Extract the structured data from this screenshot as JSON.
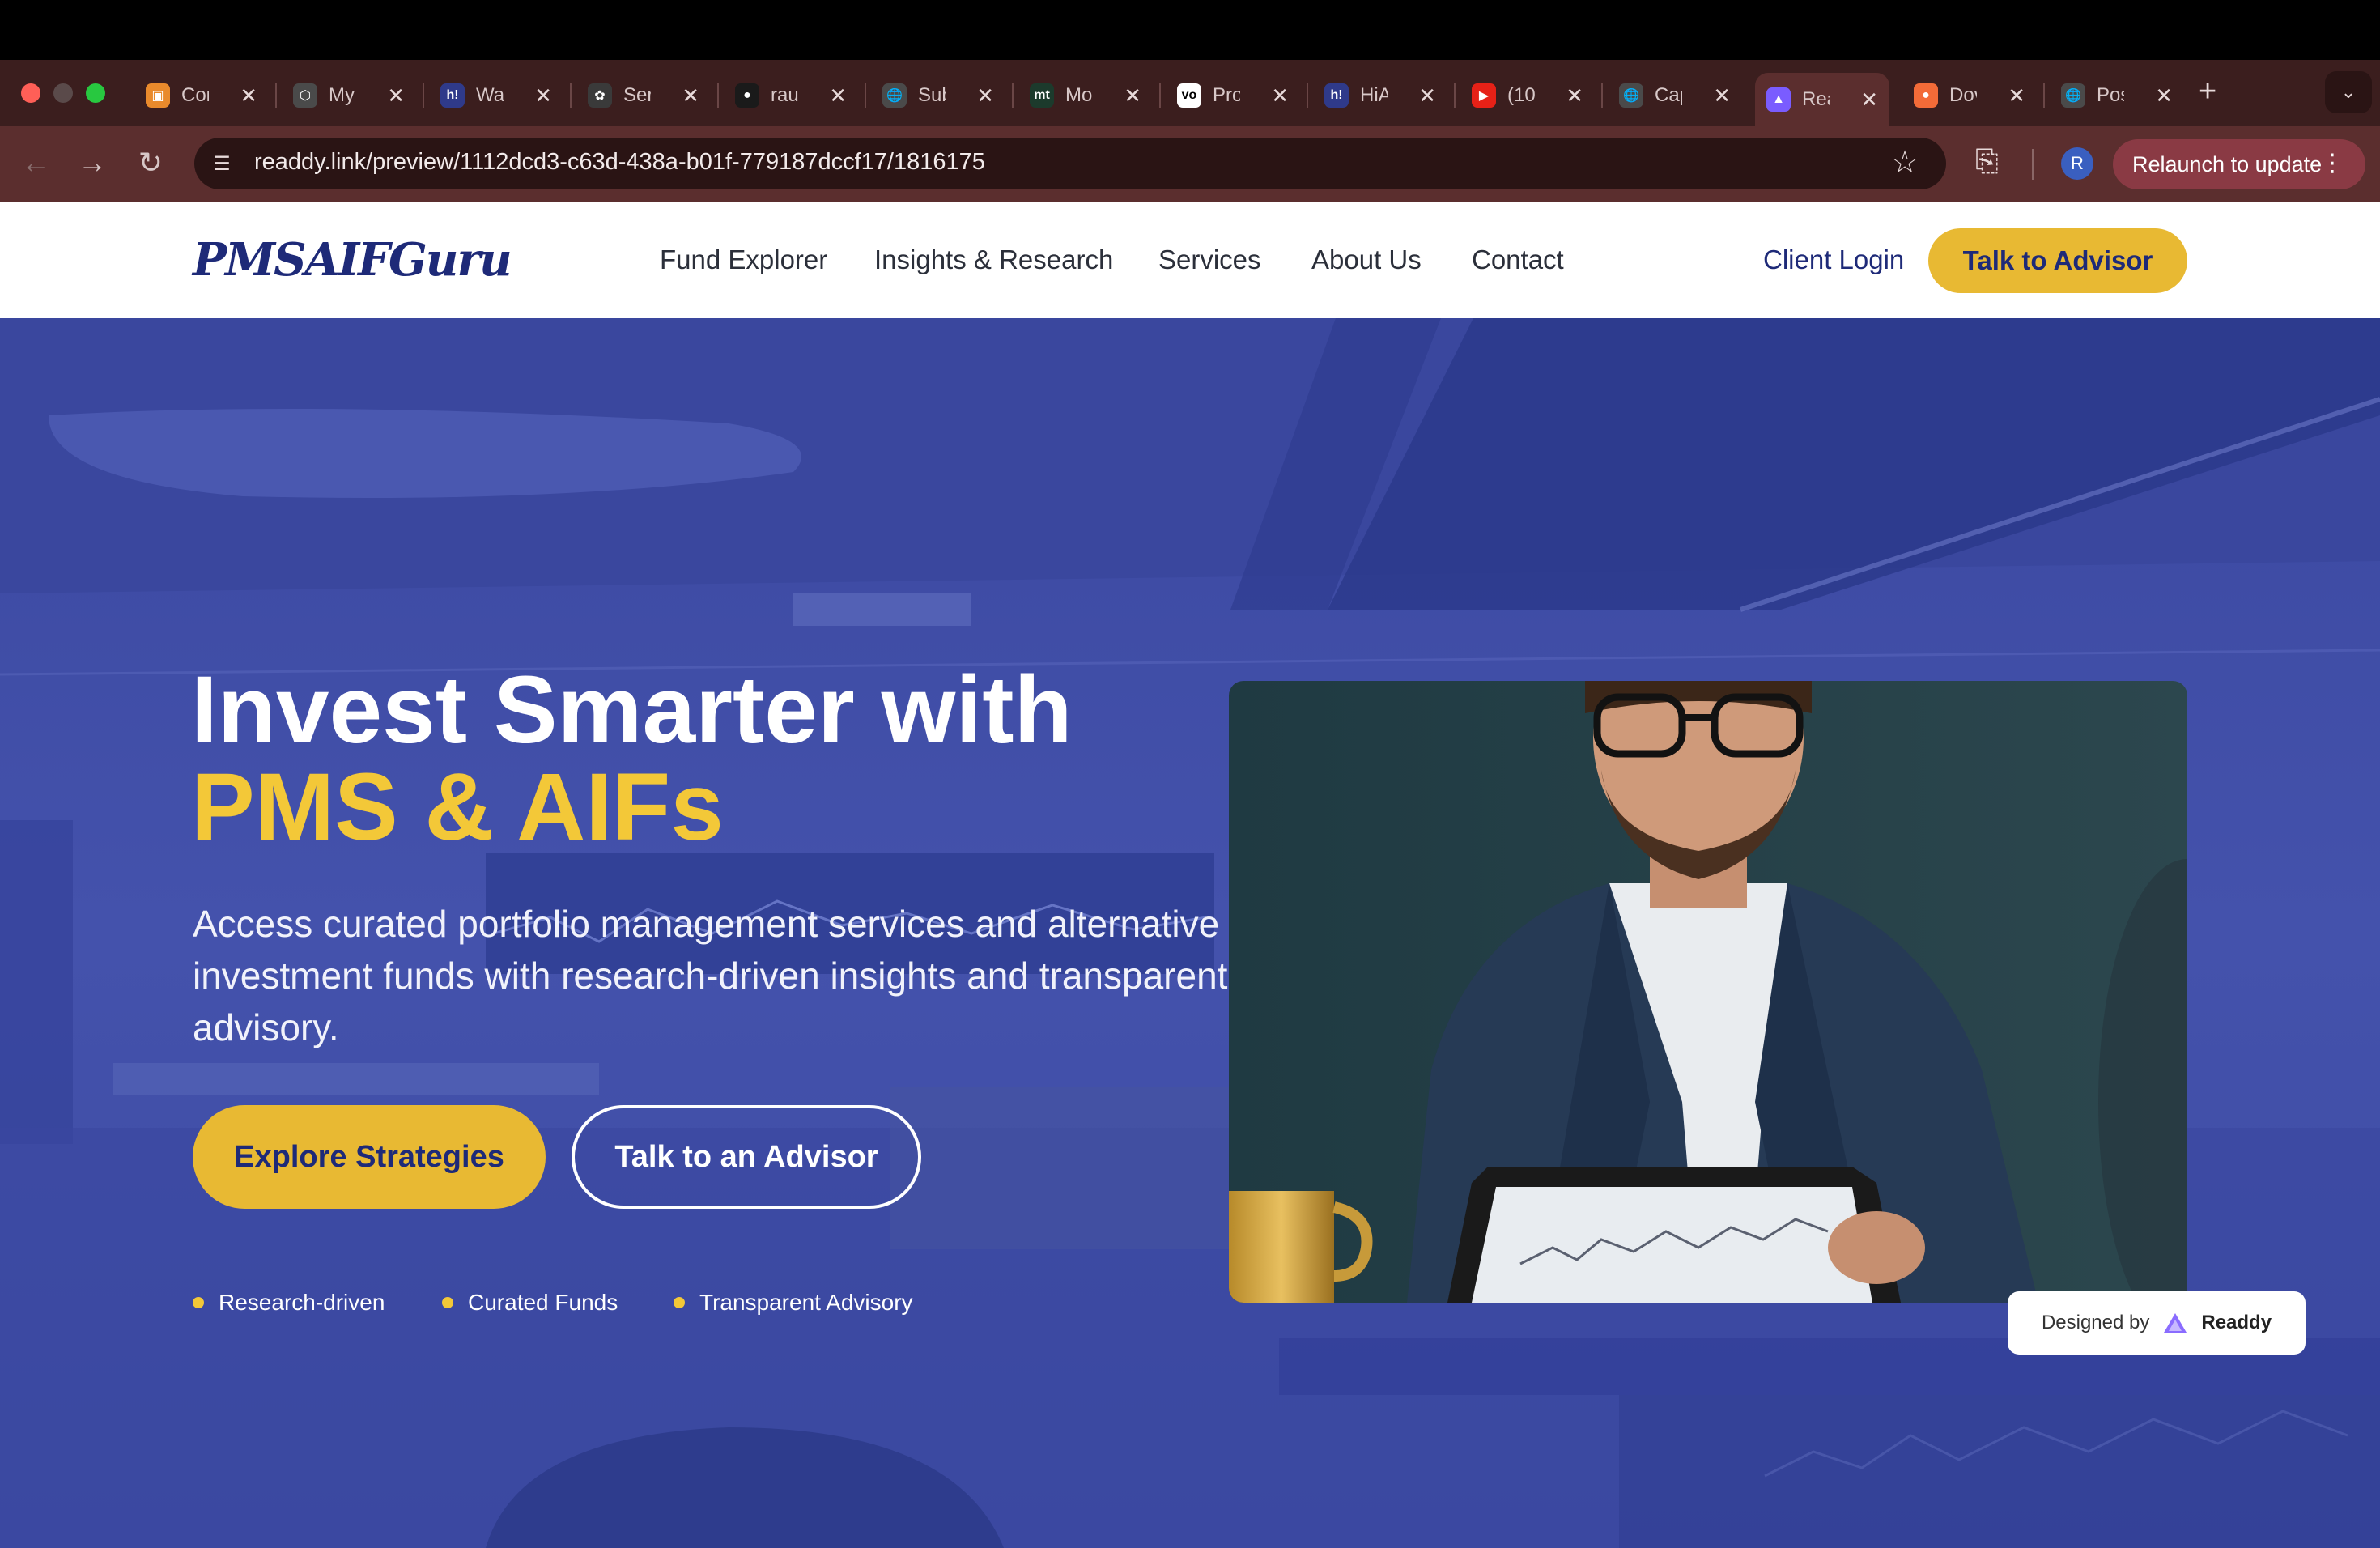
{
  "browser": {
    "tabs": [
      {
        "title": "Cor",
        "icon": "box-icon",
        "color": "#e98a2c"
      },
      {
        "title": "My",
        "icon": "hex-icon",
        "color": "#4a4a4a"
      },
      {
        "title": "Wa",
        "icon": "h-icon",
        "color": "#2f3a8a"
      },
      {
        "title": "Ser",
        "icon": "openai-icon",
        "color": "#3a3a3a"
      },
      {
        "title": "rau",
        "icon": "github-icon",
        "color": "#1a1a1a"
      },
      {
        "title": "Sub",
        "icon": "globe-icon",
        "color": "#4a4a4a"
      },
      {
        "title": "Mo",
        "icon": "mt-icon",
        "color": "#1c3a2c"
      },
      {
        "title": "Pro",
        "icon": "vo-icon",
        "color": "#ffffff"
      },
      {
        "title": "HiA",
        "icon": "h-icon",
        "color": "#2f3a8a"
      },
      {
        "title": "(10",
        "icon": "youtube-icon",
        "color": "#e62117"
      },
      {
        "title": "Cap",
        "icon": "globe-icon",
        "color": "#4a4a4a"
      },
      {
        "title": "Rea",
        "icon": "readdy-icon",
        "color": "#7a5cff",
        "active": true
      },
      {
        "title": "Dov",
        "icon": "orange-icon",
        "color": "#f36b38"
      },
      {
        "title": "Pos",
        "icon": "globe-icon",
        "color": "#4a4a4a"
      }
    ],
    "url": "readdy.link/preview/1112dcd3-c63d-438a-b01f-779187dccf17/1816175",
    "profile_initial": "R",
    "relaunch_label": "Relaunch to update"
  },
  "site": {
    "logo": "PMSAIFGuru",
    "nav": [
      "Fund Explorer",
      "Insights & Research",
      "Services",
      "About Us",
      "Contact"
    ],
    "client_login": "Client Login",
    "cta_top": "Talk to Advisor"
  },
  "hero": {
    "title_line1": "Invest Smarter with",
    "title_line2": "PMS & AIFs",
    "lead": "Access curated portfolio management services and alternative investment funds with research-driven insights and transparent advisory.",
    "primary_button": "Explore Strategies",
    "secondary_button": "Talk to an Advisor",
    "features": [
      "Research-driven",
      "Curated Funds",
      "Transparent Advisory"
    ]
  },
  "badge": {
    "prefix": "Designed by",
    "brand": "Readdy"
  },
  "colors": {
    "brand_navy": "#1e2a78",
    "accent_gold": "#e8b933",
    "hero_blue": "#3f4da3"
  }
}
